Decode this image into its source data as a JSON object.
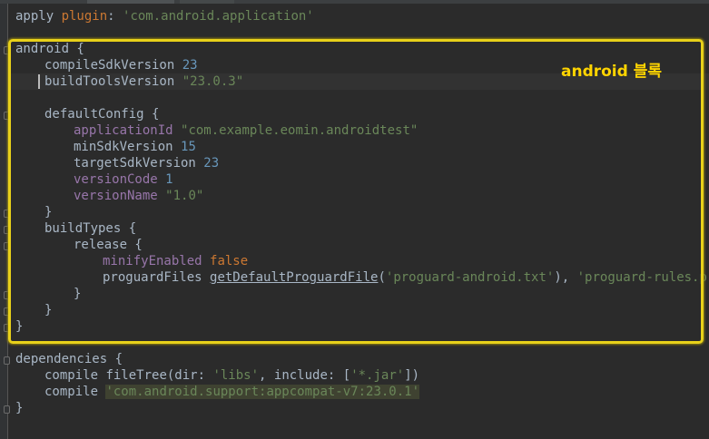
{
  "annotation": {
    "label": "android 블록"
  },
  "code": {
    "l1": [
      "apply ",
      "plugin",
      ": ",
      "'com.android.application'"
    ],
    "l3": "android {",
    "l4": [
      "compileSdkVersion ",
      "23"
    ],
    "l5": [
      "buildToolsVersion ",
      "\"23.0.3\""
    ],
    "l7": "defaultConfig {",
    "l8": [
      "applicationId ",
      "\"com.example.eomin.androidtest\""
    ],
    "l9": [
      "minSdkVersion ",
      "15"
    ],
    "l10": [
      "targetSdkVersion ",
      "23"
    ],
    "l11": [
      "versionCode ",
      "1"
    ],
    "l12": [
      "versionName ",
      "\"1.0\""
    ],
    "l13": "}",
    "l14": "buildTypes {",
    "l15": "release {",
    "l16": [
      "minifyEnabled ",
      "false"
    ],
    "l17": [
      "proguardFiles ",
      "getDefaultProguardFile",
      "(",
      "'proguard-android.txt'",
      "), ",
      "'proguard-rules.pro'"
    ],
    "l18": "}",
    "l19": "}",
    "l20": "}",
    "l22": "dependencies {",
    "l23": [
      "compile ",
      "fileTree(dir: ",
      "'libs'",
      ", include: [",
      "'*.jar'",
      "])"
    ],
    "l24": [
      "compile ",
      "'com.android.support:appcompat-v7:23.0.1'"
    ],
    "l25": "}"
  },
  "colors": {
    "background": "#2b2b2b",
    "keyword": "#cc7832",
    "string": "#6a8759",
    "number": "#6897bb",
    "property": "#9876aa",
    "highlight_border": "#e8d11a",
    "annotation_text": "#ffd400"
  }
}
